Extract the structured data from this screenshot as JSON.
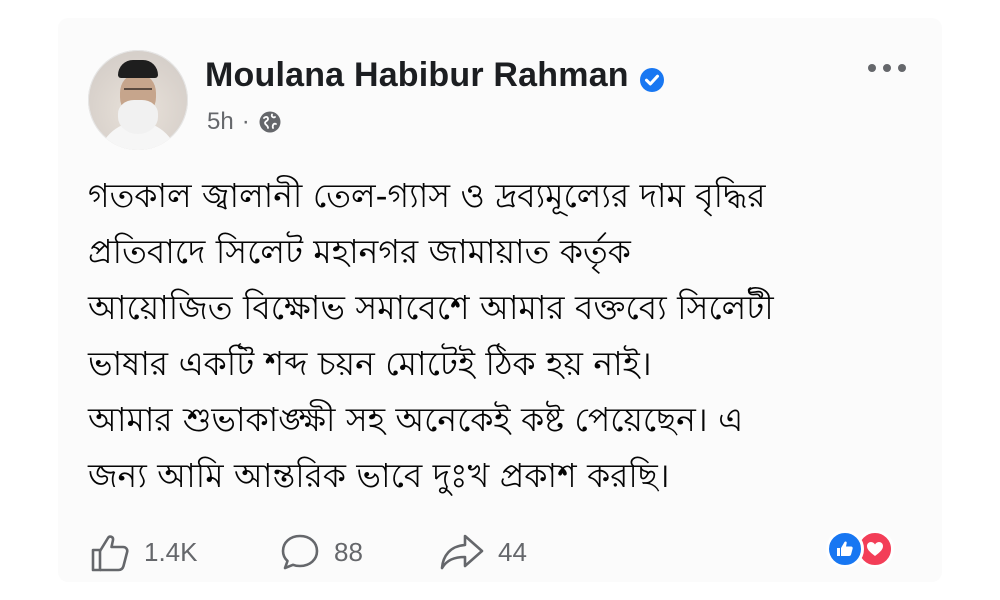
{
  "post": {
    "author": "Moulana Habibur Rahman",
    "time": "5h",
    "separator": "·",
    "lines": [
      "গতকাল জ্বালানী তেল-গ্যাস ও দ্রব্যমূল্যের দাম বৃদ্ধির",
      "প্রতিবাদে সিলেট মহানগর জামায়াত কর্তৃক",
      "আয়োজিত বিক্ষোভ সমাবেশে আমার বক্তব্যে সিলেটী",
      "ভাষার একটি শব্দ চয়ন মোটেই ঠিক হয় নাই।",
      "আমার শুভাকাঙ্ক্ষী সহ অনেকেই কষ্ট পেয়েছেন। এ",
      "জন্য আমি আন্তরিক ভাবে দুঃখ প্রকাশ করছি।"
    ]
  },
  "icons": {
    "verified": "verified-badge-icon",
    "audience": "globe-icon",
    "more": "more-options-icon",
    "like": "thumbs-up-icon",
    "comment": "comment-bubble-icon",
    "share": "share-arrow-icon",
    "reaction_like": "like-reaction-icon",
    "reaction_love": "love-reaction-icon"
  },
  "stats": {
    "likes": "1.4K",
    "comments": "88",
    "shares": "44"
  },
  "colors": {
    "verified": "#1877f2",
    "secondary_text": "#65676b",
    "reaction_like": "#1877f2",
    "reaction_love": "#f33e58"
  }
}
